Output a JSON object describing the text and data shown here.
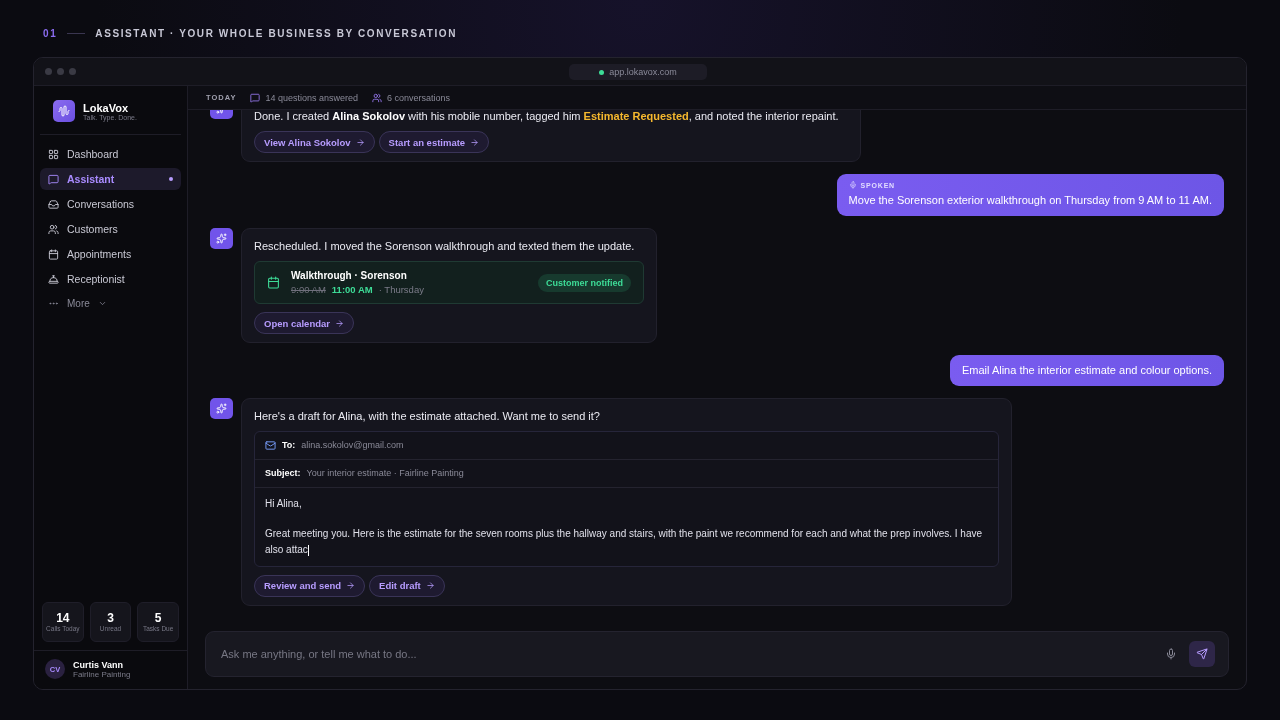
{
  "section": {
    "number": "01",
    "title": "ASSISTANT · YOUR WHOLE BUSINESS BY CONVERSATION"
  },
  "browser": {
    "url": "app.lokavox.com"
  },
  "brand": {
    "name": "LokaVox",
    "tagline": "Talk. Type. Done."
  },
  "nav": [
    {
      "label": "Dashboard",
      "selected": false,
      "dot": false
    },
    {
      "label": "Assistant",
      "selected": true,
      "dot": true
    },
    {
      "label": "Conversations",
      "selected": false,
      "dot": false
    },
    {
      "label": "Customers",
      "selected": false,
      "dot": false
    },
    {
      "label": "Appointments",
      "selected": false,
      "dot": false
    },
    {
      "label": "Receptionist",
      "selected": false,
      "dot": false
    }
  ],
  "more": {
    "label": "More"
  },
  "stats": [
    {
      "value": "14",
      "label": "Calls Today"
    },
    {
      "value": "3",
      "label": "Unread"
    },
    {
      "value": "5",
      "label": "Tasks Due"
    }
  ],
  "user": {
    "initials": "CV",
    "name": "Curtis Vann",
    "company": "Fairline Painting"
  },
  "header": {
    "day": "TODAY",
    "stats": [
      "14 questions answered",
      "6 conversations"
    ]
  },
  "messages": [
    {
      "kind": "assistant",
      "parts": [
        {
          "kind": "plain",
          "text": "Done. I created "
        },
        {
          "kind": "name",
          "text": "Alina Sokolov"
        },
        {
          "kind": "plain",
          "text": " with his mobile number, tagged him "
        },
        {
          "kind": "tag",
          "text": "Estimate Requested"
        },
        {
          "kind": "plain",
          "text": ", and noted the interior repaint."
        }
      ],
      "actions": [
        "View Alina Sokolov",
        "Start an estimate"
      ]
    },
    {
      "kind": "user",
      "tag": "SPOKEN",
      "text": "Move the Sorenson exterior walkthrough on Thursday from 9 AM to 11 AM."
    },
    {
      "kind": "assistant",
      "parts": [
        {
          "kind": "plain",
          "text": "Rescheduled. I moved the Sorenson walkthrough and texted them the update."
        }
      ],
      "card": {
        "title": "Walkthrough · Sorenson",
        "old_time": "9:00 AM",
        "new_time": "11:00 AM",
        "day": "· Thursday",
        "badge": "Customer notified"
      },
      "actions": [
        "Open calendar"
      ]
    },
    {
      "kind": "user",
      "text": "Email Alina the interior estimate and colour options."
    },
    {
      "kind": "assistant",
      "parts": [
        {
          "kind": "plain",
          "text": "Here's a draft for Alina, with the estimate attached. Want me to send it?"
        }
      ],
      "email": {
        "to_label": "To:",
        "to": "alina.sokolov@gmail.com",
        "subject_label": "Subject:",
        "subject": "Your interior estimate · Fairline Painting",
        "body": [
          "Hi Alina,",
          "Great meeting you. Here is the estimate for the seven rooms plus the hallway and stairs, with the paint we recommend for each and what the prep involves. I have also attac"
        ]
      },
      "actions": [
        "Review and send",
        "Edit draft"
      ]
    }
  ],
  "composer": {
    "placeholder": "Ask me anything, or tell me what to do..."
  }
}
